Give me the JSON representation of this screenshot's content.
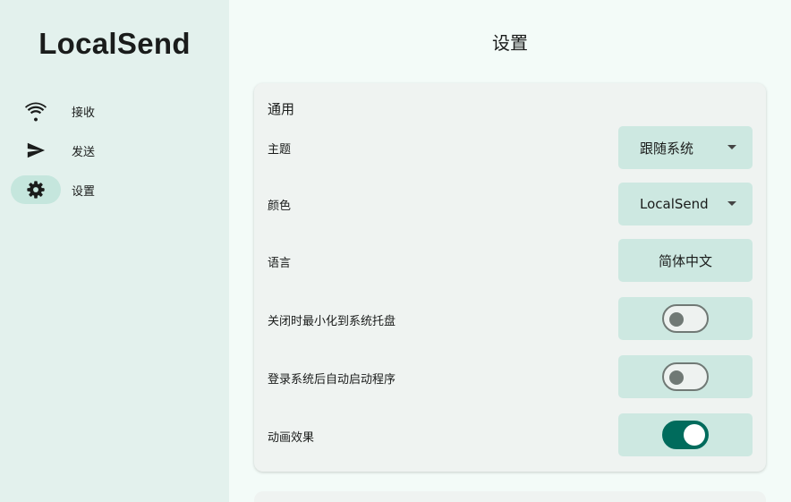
{
  "app": {
    "name": "LocalSend"
  },
  "nav": [
    {
      "label": "接收",
      "icon": "wifi-icon"
    },
    {
      "label": "发送",
      "icon": "send-icon"
    },
    {
      "label": "设置",
      "icon": "gear-icon",
      "active": true
    }
  ],
  "page": {
    "title": "设置"
  },
  "general": {
    "section_title": "通用",
    "theme": {
      "label": "主题",
      "value": "跟随系统"
    },
    "color": {
      "label": "颜色",
      "value": "LocalSend"
    },
    "language": {
      "label": "语言",
      "value": "简体中文"
    },
    "minimize_to_tray": {
      "label": "关闭时最小化到系统托盘",
      "on": false
    },
    "autostart": {
      "label": "登录系统后自动启动程序",
      "on": false
    },
    "animations": {
      "label": "动画效果",
      "on": true
    }
  },
  "colors": {
    "accent": "#006b5c",
    "sidebar_bg": "#e3f1ed",
    "control_bg": "#cde8e1",
    "active_pill": "#c5e6dd"
  }
}
